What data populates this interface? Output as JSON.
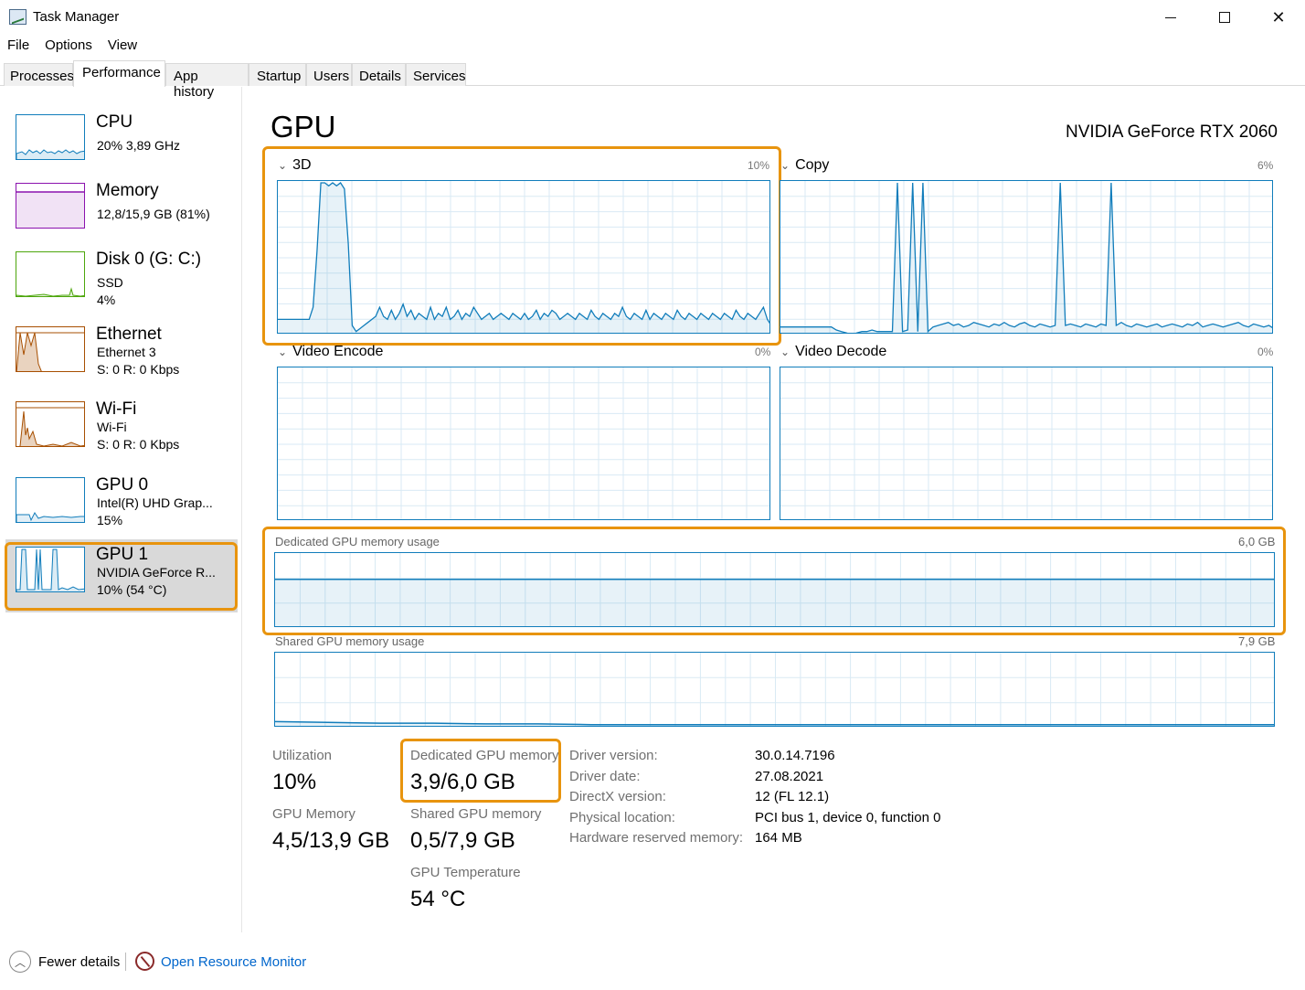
{
  "window": {
    "title": "Task Manager",
    "minimize_icon": "minimize-icon",
    "maximize_icon": "maximize-icon",
    "close_icon": "close-icon"
  },
  "menu": [
    "File",
    "Options",
    "View"
  ],
  "tabs": [
    "Processes",
    "Performance",
    "App history",
    "Startup",
    "Users",
    "Details",
    "Services"
  ],
  "active_tab": "Performance",
  "sidebar": [
    {
      "name": "CPU",
      "sub1": "20%  3,89 GHz",
      "sub2": "",
      "sub3": "",
      "color": "#117dbb"
    },
    {
      "name": "Memory",
      "sub1": "12,8/15,9 GB (81%)",
      "sub2": "",
      "sub3": "",
      "color": "#8b12ae"
    },
    {
      "name": "Disk 0 (G: C:)",
      "sub1": "SSD",
      "sub2": "4%",
      "sub3": "",
      "color": "#4da60c"
    },
    {
      "name": "Ethernet",
      "sub1": "Ethernet 3",
      "sub2": "S: 0  R: 0 Kbps",
      "sub3": "",
      "color": "#a74f01"
    },
    {
      "name": "Wi-Fi",
      "sub1": "Wi-Fi",
      "sub2": "S: 0  R: 0 Kbps",
      "sub3": "",
      "color": "#a74f01"
    },
    {
      "name": "GPU 0",
      "sub1": "Intel(R) UHD Grap...",
      "sub2": "15%",
      "sub3": "",
      "color": "#117dbb"
    },
    {
      "name": "GPU 1",
      "sub1": "NVIDIA GeForce R...",
      "sub2": "10%  (54 °C)",
      "sub3": "",
      "color": "#117dbb"
    }
  ],
  "main": {
    "title": "GPU",
    "model": "NVIDIA GeForce RTX 2060",
    "engines": [
      {
        "label": "3D",
        "max": "10%"
      },
      {
        "label": "Copy",
        "max": "6%"
      },
      {
        "label": "Video Encode",
        "max": "0%"
      },
      {
        "label": "Video Decode",
        "max": "0%"
      }
    ],
    "dedicated": {
      "label": "Dedicated GPU memory usage",
      "max": "6,0 GB",
      "fraction": 0.65
    },
    "shared": {
      "label": "Shared GPU memory usage",
      "max": "7,9 GB",
      "fraction": 0.06
    }
  },
  "stats": {
    "utilization_label": "Utilization",
    "utilization": "10%",
    "dedicated_label": "Dedicated GPU memory",
    "dedicated": "3,9/6,0 GB",
    "gpu_memory_label": "GPU Memory",
    "gpu_memory": "4,5/13,9 GB",
    "shared_label": "Shared GPU memory",
    "shared": "0,5/7,9 GB",
    "temp_label": "GPU Temperature",
    "temp": "54 °C"
  },
  "info": [
    {
      "label": "Driver version:",
      "value": "30.0.14.7196"
    },
    {
      "label": "Driver date:",
      "value": "27.08.2021"
    },
    {
      "label": "DirectX version:",
      "value": "12 (FL 12.1)"
    },
    {
      "label": "Physical location:",
      "value": "PCI bus 1, device 0, function 0"
    },
    {
      "label": "Hardware reserved memory:",
      "value": "164 MB"
    }
  ],
  "footer": {
    "fewer_details": "Fewer details",
    "open_resource_monitor": "Open Resource Monitor"
  },
  "series": {
    "engine_3d": [
      10,
      10,
      10,
      10,
      10,
      10,
      10,
      10,
      10,
      18,
      55,
      100,
      100,
      98,
      100,
      98,
      100,
      96,
      60,
      6,
      2,
      4,
      6,
      8,
      10,
      12,
      18,
      12,
      10,
      16,
      10,
      14,
      20,
      12,
      16,
      10,
      14,
      12,
      10,
      18,
      10,
      14,
      12,
      18,
      10,
      12,
      16,
      10,
      14,
      12,
      18,
      14,
      10,
      12,
      14,
      10,
      12,
      14,
      12,
      10,
      14,
      12,
      10,
      14,
      10,
      12,
      16,
      10,
      14,
      12,
      16,
      14,
      10,
      12,
      14,
      12,
      10,
      14,
      12,
      10,
      16,
      12,
      10,
      14,
      12,
      10,
      14,
      12,
      18,
      12,
      10,
      14,
      12,
      10,
      16,
      10,
      14,
      12,
      10,
      14,
      12,
      10,
      16,
      12,
      10,
      14,
      12,
      10,
      14,
      12,
      10,
      14,
      12,
      10,
      14,
      12,
      10,
      16,
      12,
      10,
      14,
      12,
      10,
      14,
      18,
      10,
      6
    ],
    "engine_copy": [
      5,
      5,
      5,
      5,
      5,
      5,
      5,
      5,
      5,
      5,
      5,
      3,
      2,
      1,
      0,
      1,
      2,
      2,
      3,
      2,
      2,
      2,
      2,
      100,
      2,
      3,
      100,
      2,
      100,
      2,
      5,
      6,
      7,
      8,
      6,
      7,
      5,
      6,
      8,
      7,
      6,
      5,
      7,
      6,
      8,
      6,
      5,
      7,
      8,
      6,
      5,
      7,
      6,
      5,
      6,
      100,
      6,
      7,
      6,
      5,
      7,
      6,
      5,
      7,
      6,
      100,
      6,
      8,
      6,
      5,
      7,
      6,
      5,
      6,
      7,
      5,
      6,
      7,
      6,
      5,
      7,
      6,
      8,
      5,
      6,
      7,
      6,
      5,
      6,
      7,
      8,
      6,
      5,
      7,
      6,
      5,
      6,
      4
    ],
    "shared_mem": [
      8,
      7,
      6,
      6,
      5,
      5,
      4,
      4,
      4,
      4,
      4,
      4,
      4,
      4,
      4,
      4,
      4,
      4,
      4,
      4
    ]
  }
}
